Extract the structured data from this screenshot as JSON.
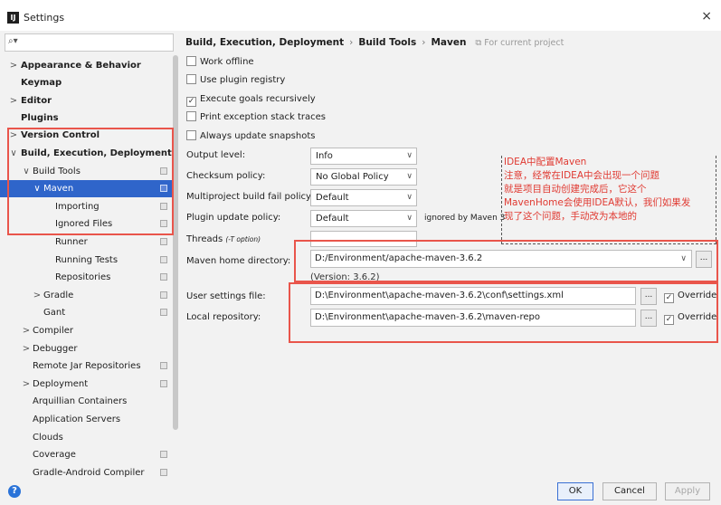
{
  "window": {
    "title": "Settings",
    "app_icon_text": "IJ",
    "close_symbol": "×"
  },
  "search": {
    "icon": "⌕▾",
    "value": ""
  },
  "sidebar": {
    "items": [
      {
        "label": "Appearance & Behavior",
        "arrow": ">",
        "bold": true
      },
      {
        "label": "Keymap",
        "arrow": "",
        "bold": true
      },
      {
        "label": "Editor",
        "arrow": ">",
        "bold": true
      },
      {
        "label": "Plugins",
        "arrow": "",
        "bold": true
      },
      {
        "label": "Version Control",
        "arrow": ">",
        "bold": true
      },
      {
        "label": "Build, Execution, Deployment",
        "arrow": "∨",
        "bold": true
      },
      {
        "label": "Build Tools",
        "arrow": "∨",
        "bold": false
      },
      {
        "label": "Maven",
        "arrow": "∨",
        "bold": false
      },
      {
        "label": "Importing",
        "arrow": "",
        "bold": false
      },
      {
        "label": "Ignored Files",
        "arrow": "",
        "bold": false
      },
      {
        "label": "Runner",
        "arrow": "",
        "bold": false
      },
      {
        "label": "Running Tests",
        "arrow": "",
        "bold": false
      },
      {
        "label": "Repositories",
        "arrow": "",
        "bold": false
      },
      {
        "label": "Gradle",
        "arrow": ">",
        "bold": false
      },
      {
        "label": "Gant",
        "arrow": "",
        "bold": false
      },
      {
        "label": "Compiler",
        "arrow": ">",
        "bold": false
      },
      {
        "label": "Debugger",
        "arrow": ">",
        "bold": false
      },
      {
        "label": "Remote Jar Repositories",
        "arrow": "",
        "bold": false
      },
      {
        "label": "Deployment",
        "arrow": ">",
        "bold": false
      },
      {
        "label": "Arquillian Containers",
        "arrow": "",
        "bold": false
      },
      {
        "label": "Application Servers",
        "arrow": "",
        "bold": false
      },
      {
        "label": "Clouds",
        "arrow": "",
        "bold": false
      },
      {
        "label": "Coverage",
        "arrow": "",
        "bold": false
      },
      {
        "label": "Gradle-Android Compiler",
        "arrow": "",
        "bold": false
      }
    ]
  },
  "breadcrumb": {
    "parts": [
      "Build, Execution, Deployment",
      "Build Tools",
      "Maven"
    ],
    "separator": "›",
    "scope_note": "⧉ For current project"
  },
  "checkboxes": [
    {
      "label": "Work offline",
      "checked": false
    },
    {
      "label": "Use plugin registry",
      "checked": false
    },
    {
      "label": "Execute goals recursively",
      "checked": true
    },
    {
      "label": "Print exception stack traces",
      "checked": false
    },
    {
      "label": "Always update snapshots",
      "checked": false
    }
  ],
  "check_mark": "✓",
  "dropdowns": [
    {
      "label": "Output level:",
      "value": "Info"
    },
    {
      "label": "Checksum policy:",
      "value": "No Global Policy"
    },
    {
      "label": "Multiproject build fail policy:",
      "value": "Default"
    },
    {
      "label": "Plugin update policy:",
      "value": "Default"
    }
  ],
  "caret": "∨",
  "ignored_note": "ignored by Maven 3",
  "threads": {
    "label": "Threads",
    "hint": "(-T option)",
    "value": ""
  },
  "maven_home": {
    "label": "Maven home directory:",
    "value": "D:/Environment/apache-maven-3.6.2",
    "version": "(Version: 3.6.2)"
  },
  "user_settings": {
    "label": "User settings file:",
    "value": "D:\\Environment\\apache-maven-3.6.2\\conf\\settings.xml",
    "override_label": "Override",
    "override": true
  },
  "local_repo": {
    "label": "Local repository:",
    "value": "D:\\Environment\\apache-maven-3.6.2\\maven-repo",
    "override_label": "Override",
    "override": true
  },
  "browse_label": "...",
  "note_lines": [
    "IDEA中配置Maven",
    "注意，经常在IDEA中会出现一个问题",
    "就是项目自动创建完成后，它这个",
    "MavenHome会使用IDEA默认，我们如果发",
    "现了这个问题，手动改为本地的"
  ],
  "footer": {
    "help_icon": "?",
    "ok": "OK",
    "cancel": "Cancel",
    "apply": "Apply"
  },
  "colors": {
    "selection": "#2f65ca",
    "annotation": "#e9554b",
    "note_text": "#e03a32"
  }
}
